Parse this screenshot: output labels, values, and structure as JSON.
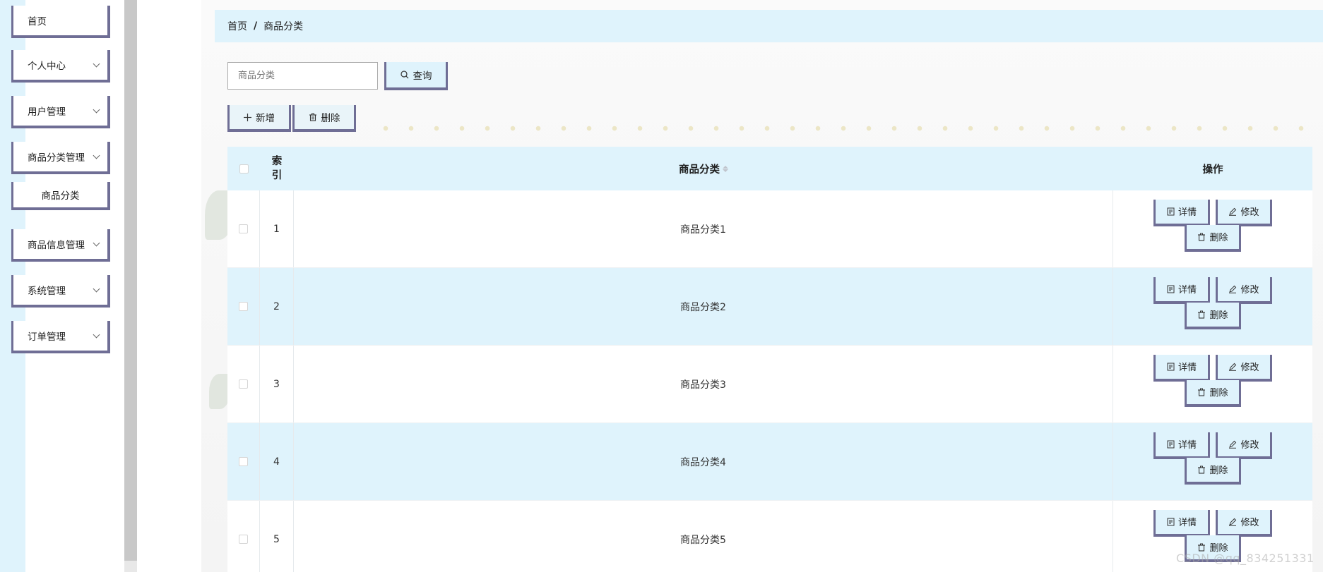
{
  "sidebar": {
    "items": [
      {
        "label": "首页",
        "has_chevron": false
      },
      {
        "label": "个人中心",
        "has_chevron": true
      },
      {
        "label": "用户管理",
        "has_chevron": true
      },
      {
        "label": "商品分类管理",
        "has_chevron": true
      },
      {
        "label": "商品信息管理",
        "has_chevron": true
      },
      {
        "label": "系统管理",
        "has_chevron": true
      },
      {
        "label": "订单管理",
        "has_chevron": true
      }
    ],
    "submenu": {
      "label": "商品分类"
    }
  },
  "breadcrumb": {
    "home": "首页",
    "separator": "/",
    "current": "商品分类"
  },
  "search": {
    "placeholder": "商品分类",
    "button_label": "查询"
  },
  "toolbar": {
    "add_label": "新增",
    "delete_label": "删除"
  },
  "table": {
    "headers": {
      "index": "索引",
      "name": "商品分类",
      "ops": "操作"
    },
    "rows": [
      {
        "index": "1",
        "name": "商品分类1"
      },
      {
        "index": "2",
        "name": "商品分类2"
      },
      {
        "index": "3",
        "name": "商品分类3"
      },
      {
        "index": "4",
        "name": "商品分类4"
      },
      {
        "index": "5",
        "name": "商品分类5"
      }
    ],
    "op_labels": {
      "detail": "详情",
      "edit": "修改",
      "delete": "删除"
    }
  },
  "watermark": "CSDN @qq_834251331",
  "colors": {
    "accent_light": "#dff3fc",
    "border_accent": "#6f6e95"
  }
}
